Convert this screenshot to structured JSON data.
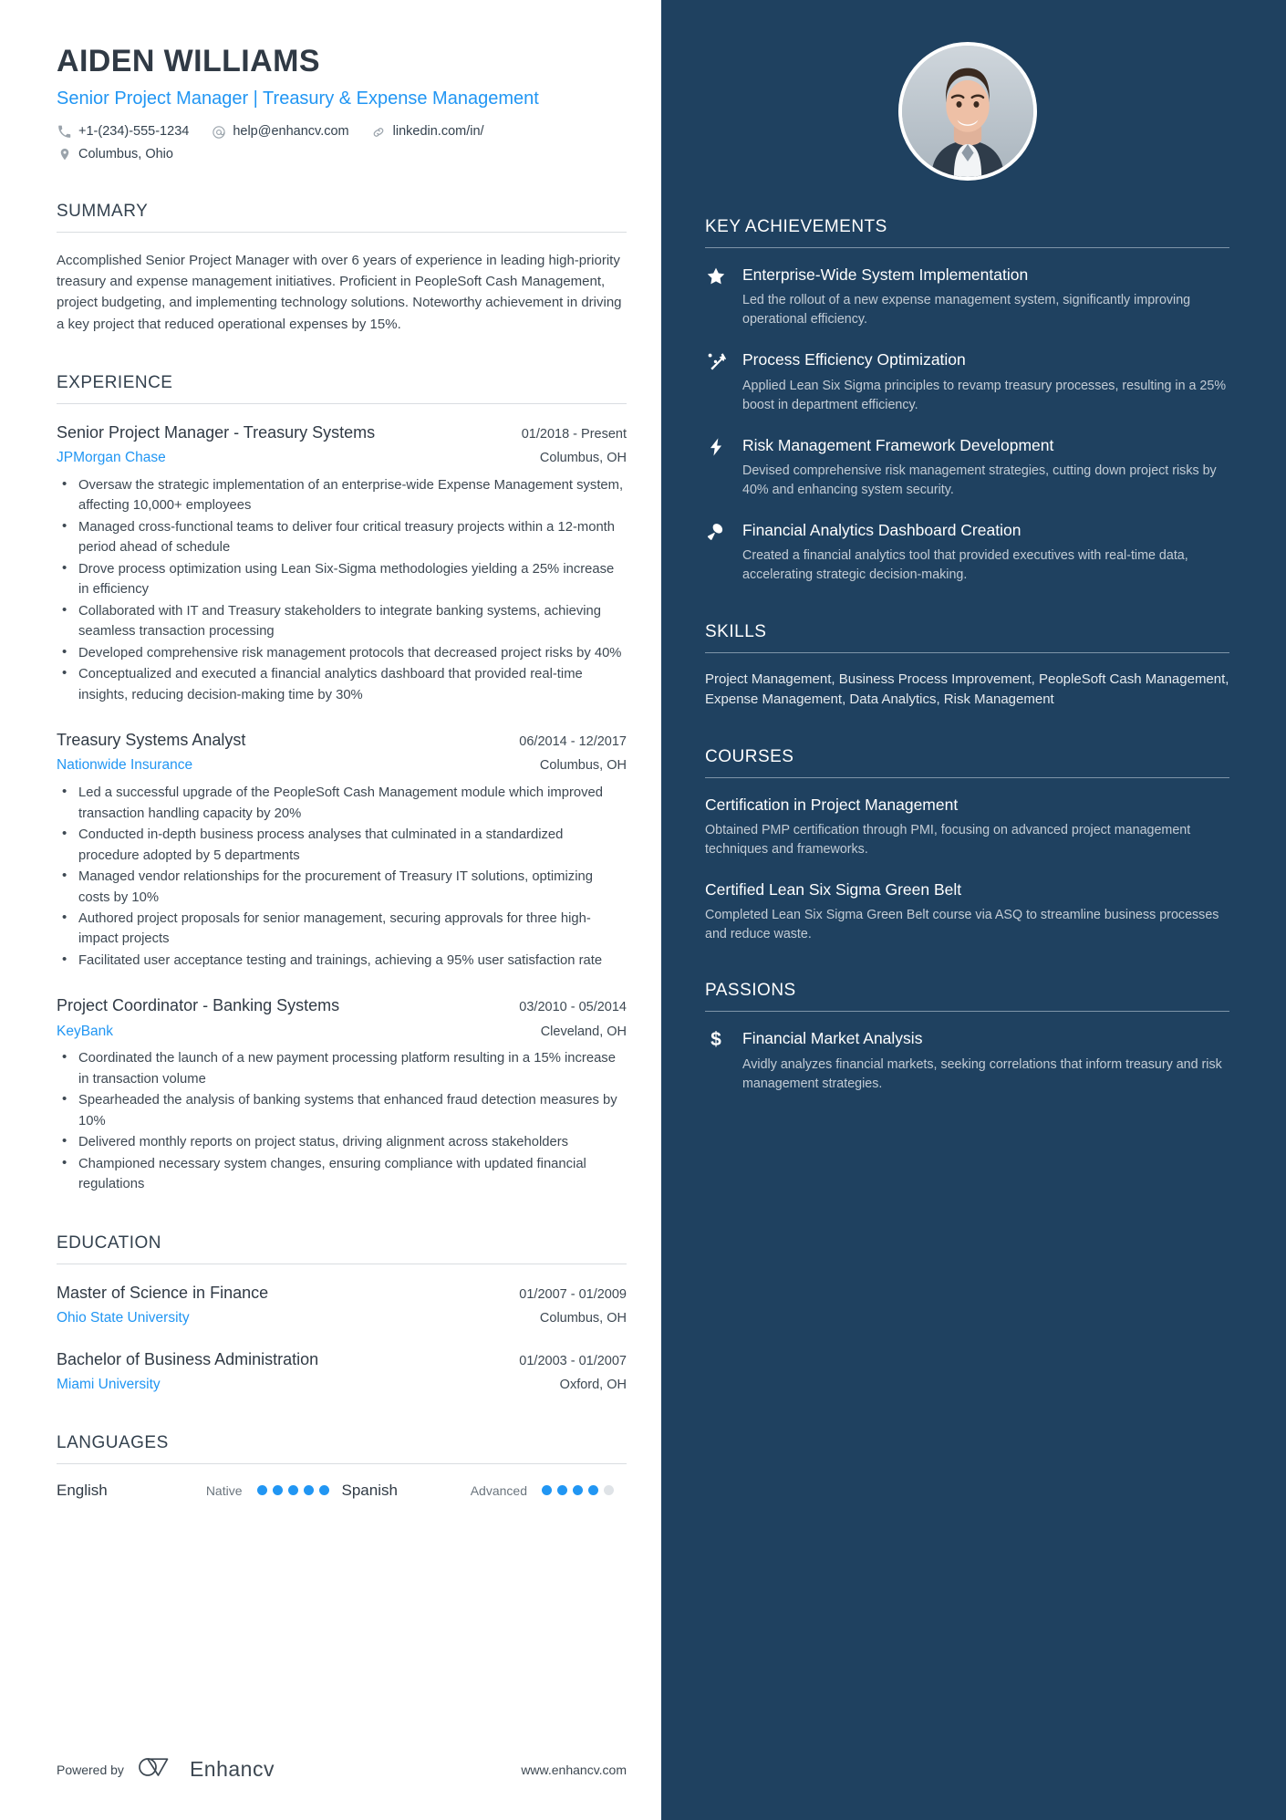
{
  "header": {
    "name": "AIDEN WILLIAMS",
    "headline": "Senior Project Manager | Treasury & Expense Management",
    "contacts": [
      {
        "icon": "phone-icon",
        "text": "+1-(234)-555-1234"
      },
      {
        "icon": "email-icon",
        "text": "help@enhancv.com"
      },
      {
        "icon": "link-icon",
        "text": "linkedin.com/in/"
      }
    ],
    "location": {
      "icon": "location-pin-icon",
      "text": "Columbus, Ohio"
    },
    "accent_color": "#2196f3",
    "sidebar_color": "#1f4160"
  },
  "summary": {
    "title": "SUMMARY",
    "text": "Accomplished Senior Project Manager with over 6 years of experience in leading high-priority treasury and expense management initiatives. Proficient in PeopleSoft Cash Management, project budgeting, and implementing technology solutions. Noteworthy achievement in driving a key project that reduced operational expenses by 15%."
  },
  "experience": {
    "title": "EXPERIENCE",
    "entries": [
      {
        "role": "Senior Project Manager - Treasury Systems",
        "dates": "01/2018 - Present",
        "company": "JPMorgan Chase",
        "location": "Columbus, OH",
        "bullets": [
          "Oversaw the strategic implementation of an enterprise-wide Expense Management system, affecting 10,000+ employees",
          "Managed cross-functional teams to deliver four critical treasury projects within a 12-month period ahead of schedule",
          "Drove process optimization using Lean Six-Sigma methodologies yielding a 25% increase in efficiency",
          "Collaborated with IT and Treasury stakeholders to integrate banking systems, achieving seamless transaction processing",
          "Developed comprehensive risk management protocols that decreased project risks by 40%",
          "Conceptualized and executed a financial analytics dashboard that provided real-time insights, reducing decision-making time by 30%"
        ]
      },
      {
        "role": "Treasury Systems Analyst",
        "dates": "06/2014 - 12/2017",
        "company": "Nationwide Insurance",
        "location": "Columbus, OH",
        "bullets": [
          "Led a successful upgrade of the PeopleSoft Cash Management module which improved transaction handling capacity by 20%",
          "Conducted in-depth business process analyses that culminated in a standardized procedure adopted by 5 departments",
          "Managed vendor relationships for the procurement of Treasury IT solutions, optimizing costs by 10%",
          "Authored project proposals for senior management, securing approvals for three high-impact projects",
          "Facilitated user acceptance testing and trainings, achieving a 95% user satisfaction rate"
        ]
      },
      {
        "role": "Project Coordinator - Banking Systems",
        "dates": "03/2010 - 05/2014",
        "company": "KeyBank",
        "location": "Cleveland, OH",
        "bullets": [
          "Coordinated the launch of a new payment processing platform resulting in a 15% increase in transaction volume",
          "Spearheaded the analysis of banking systems that enhanced fraud detection measures by 10%",
          "Delivered monthly reports on project status, driving alignment across stakeholders",
          "Championed necessary system changes, ensuring compliance with updated financial regulations"
        ]
      }
    ]
  },
  "education": {
    "title": "EDUCATION",
    "entries": [
      {
        "degree": "Master of Science in Finance",
        "dates": "01/2007 - 01/2009",
        "school": "Ohio State University",
        "location": "Columbus, OH"
      },
      {
        "degree": "Bachelor of Business Administration",
        "dates": "01/2003 - 01/2007",
        "school": "Miami University",
        "location": "Oxford, OH"
      }
    ]
  },
  "languages": {
    "title": "LANGUAGES",
    "items": [
      {
        "name": "English",
        "level": "Native",
        "filled": 5,
        "total": 5
      },
      {
        "name": "Spanish",
        "level": "Advanced",
        "filled": 4,
        "total": 5
      }
    ]
  },
  "footer": {
    "powered_by": "Powered by",
    "brand": "Enhancv",
    "url": "www.enhancv.com"
  },
  "key_achievements": {
    "title": "KEY ACHIEVEMENTS",
    "items": [
      {
        "icon": "star-icon",
        "title": "Enterprise-Wide System Implementation",
        "desc": "Led the rollout of a new expense management system, significantly improving operational efficiency."
      },
      {
        "icon": "trending-up-icon",
        "title": "Process Efficiency Optimization",
        "desc": "Applied Lean Six Sigma principles to revamp treasury processes, resulting in a 25% boost in department efficiency."
      },
      {
        "icon": "lightning-bolt-icon",
        "title": "Risk Management Framework Development",
        "desc": "Devised comprehensive risk management strategies, cutting down project risks by 40% and enhancing system security."
      },
      {
        "icon": "megaphone-icon",
        "title": "Financial Analytics Dashboard Creation",
        "desc": "Created a financial analytics tool that provided executives with real-time data, accelerating strategic decision-making."
      }
    ]
  },
  "skills": {
    "title": "SKILLS",
    "text": "Project Management, Business Process Improvement, PeopleSoft Cash Management, Expense Management, Data Analytics, Risk Management"
  },
  "courses": {
    "title": "COURSES",
    "items": [
      {
        "title": "Certification in Project Management",
        "desc": "Obtained PMP certification through PMI, focusing on advanced project management techniques and frameworks."
      },
      {
        "title": "Certified Lean Six Sigma Green Belt",
        "desc": "Completed Lean Six Sigma Green Belt course via ASQ to streamline business processes and reduce waste."
      }
    ]
  },
  "passions": {
    "title": "PASSIONS",
    "items": [
      {
        "icon": "dollar-sign-icon",
        "title": "Financial Market Analysis",
        "desc": "Avidly analyzes financial markets, seeking correlations that inform treasury and risk management strategies."
      }
    ]
  }
}
